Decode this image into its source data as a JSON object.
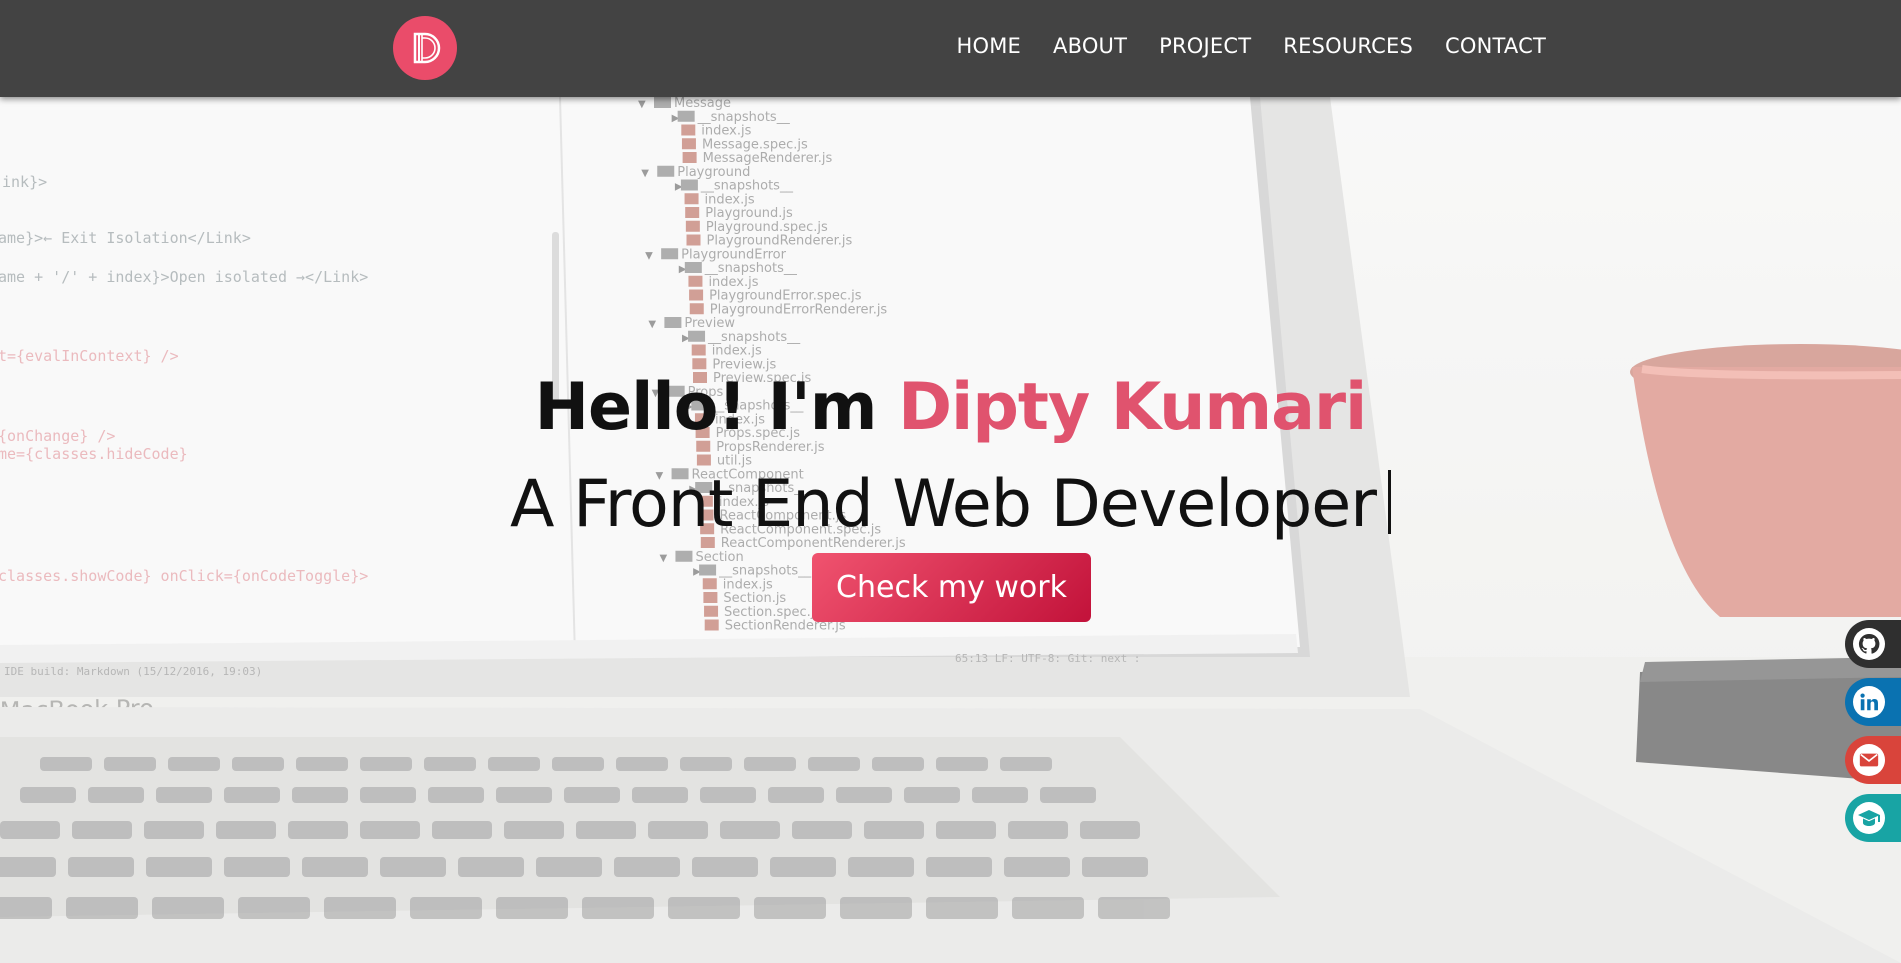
{
  "nav": {
    "logo_letter": "D",
    "links": [
      "HOME",
      "ABOUT",
      "PROJECT",
      "RESOURCES",
      "CONTACT"
    ]
  },
  "hero": {
    "greeting": "Hello! I'm ",
    "name": "Dipty Kumari",
    "subtitle": "A Front End Web Developer",
    "cta_label": "Check my work"
  },
  "background": {
    "laptop_label": "MacBook Pro",
    "code_lines": [
      "ink}>",
      "ame}>← Exit Isolation</Link>",
      "ame + '/' + index}>Open isolated →</Link>",
      "t={evalInContext} />",
      "{onChange} />",
      "me={classes.hideCode}",
      "classes.showCode} onClick={onCodeToggle}>"
    ],
    "file_tree": [
      "Message",
      "__snapshots__",
      "index.js",
      "Message.spec.js",
      "MessageRenderer.js",
      "Playground",
      "__snapshots__",
      "index.js",
      "Playground.js",
      "Playground.spec.js",
      "PlaygroundRenderer.js",
      "PlaygroundError",
      "__snapshots__",
      "index.js",
      "PlaygroundError.spec.js",
      "PlaygroundErrorRenderer.js",
      "Preview",
      "__snapshots__",
      "index.js",
      "Preview.js",
      "Preview.spec.js",
      "Props",
      "__snapshots__",
      "index.js",
      "Props.spec.js",
      "PropsRenderer.js",
      "util.js",
      "ReactComponent",
      "__snapshots__",
      "index.js",
      "ReactComponent.js",
      "ReactComponent.spec.js",
      "ReactComponentRenderer.js",
      "Section",
      "__snapshots__",
      "index.js",
      "Section.js",
      "Section.spec.js",
      "SectionRenderer.js"
    ],
    "status_left": "IDE build: Markdown (15/12/2016, 19:03)",
    "status_right": "65:13   LF:   UTF-8:   Git: next :"
  },
  "social": [
    {
      "name": "github",
      "color": "#2f2f2f"
    },
    {
      "name": "linkedin",
      "color": "#0a72b1"
    },
    {
      "name": "email",
      "color": "#d9443b"
    },
    {
      "name": "education",
      "color": "#18a4a4"
    }
  ],
  "colors": {
    "navbar": "#434343",
    "accent": "#ea4c6a",
    "name": "#e0536e"
  }
}
